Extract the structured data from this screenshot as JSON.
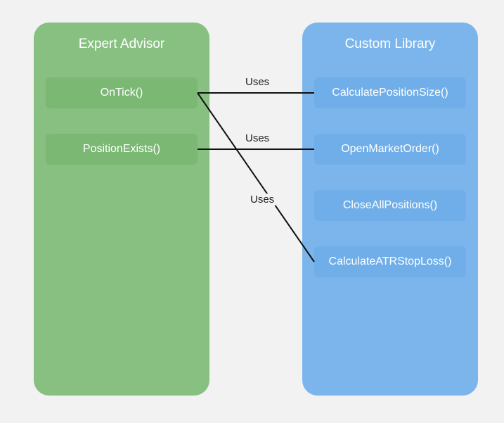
{
  "left_panel": {
    "title": "Expert Advisor",
    "nodes": [
      {
        "label": "OnTick()"
      },
      {
        "label": "PositionExists()"
      }
    ]
  },
  "right_panel": {
    "title": "Custom Library",
    "nodes": [
      {
        "label": "CalculatePositionSize()"
      },
      {
        "label": "OpenMarketOrder()"
      },
      {
        "label": "CloseAllPositions()"
      },
      {
        "label": "CalculateATRStopLoss()"
      }
    ]
  },
  "edges": [
    {
      "label": "Uses"
    },
    {
      "label": "Uses"
    },
    {
      "label": "Uses"
    }
  ],
  "colors": {
    "leftPanel": "#87c080",
    "rightPanel": "#7cb5eb",
    "leftNode": "#7ab873",
    "rightNode": "#6faee8",
    "background": "#f2f2f2"
  }
}
